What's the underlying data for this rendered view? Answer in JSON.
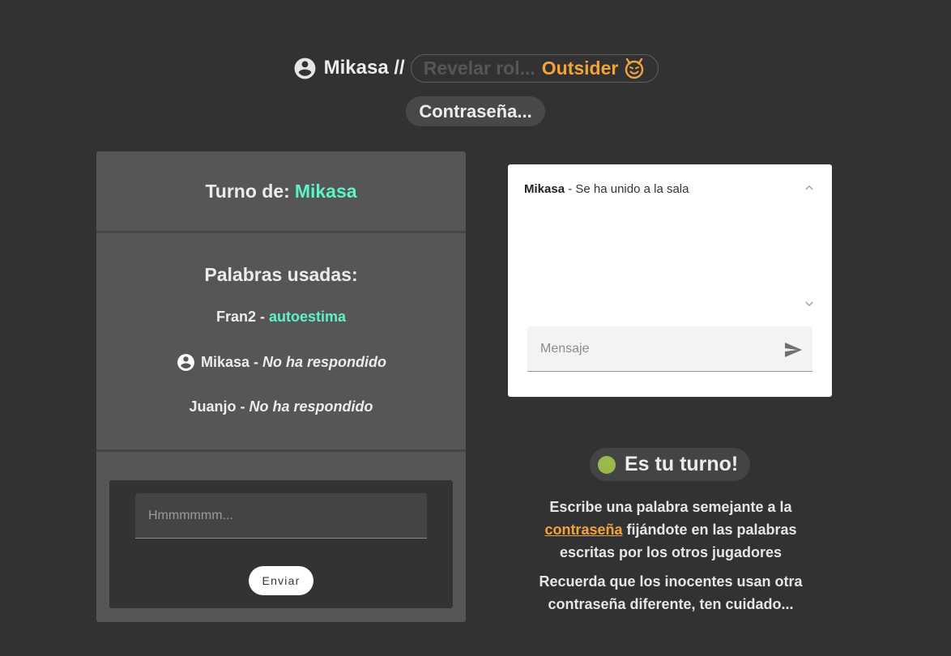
{
  "header": {
    "user_name": "Mikasa //",
    "reveal_label": "Revelar rol...",
    "role": "Outsider",
    "role_icon": "smiling-devil-icon",
    "password_button": "Contraseña..."
  },
  "turn": {
    "label": "Turno de:",
    "player": "Mikasa"
  },
  "used_words": {
    "title": "Palabras usadas:",
    "entries": [
      {
        "player": "Fran2 -",
        "word": "autoestima",
        "is_self": false
      },
      {
        "player": "Mikasa -",
        "word": "No ha respondido",
        "is_self": true
      },
      {
        "player": "Juanjo -",
        "word": "No ha respondido",
        "is_self": false
      }
    ]
  },
  "word_form": {
    "placeholder": "Hmmmmmm...",
    "submit_label": "Enviar"
  },
  "chat": {
    "messages": [
      {
        "user": "Mikasa",
        "text": " - Se ha unido a la sala"
      }
    ],
    "input_placeholder": "Mensaje"
  },
  "status": {
    "text": "Es tu turno!",
    "dot_color": "#9bb94b"
  },
  "instructions": {
    "part1": "Escribe una palabra semejante a la ",
    "link": "contraseña",
    "part2": " fijándote en las palabras escritas por los otros jugadores",
    "warning": "Recuerda que los inocentes usan otra contraseña diferente, ten cuidado..."
  },
  "colors": {
    "background": "#323232",
    "panel": "#565656",
    "accent_teal": "#5ef2c9",
    "accent_orange": "#f2a33a"
  }
}
